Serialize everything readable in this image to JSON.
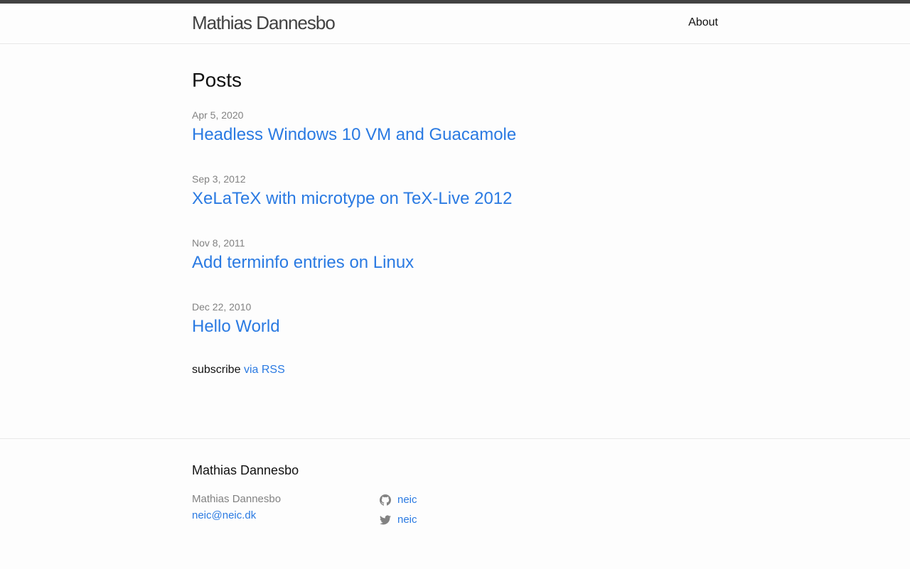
{
  "header": {
    "site_title": "Mathias Dannesbo",
    "nav": [
      {
        "label": "About"
      }
    ]
  },
  "main": {
    "heading": "Posts",
    "posts": [
      {
        "date": "Apr 5, 2020",
        "title": "Headless Windows 10 VM and Guacamole"
      },
      {
        "date": "Sep 3, 2012",
        "title": "XeLaTeX with microtype on TeX-Live 2012"
      },
      {
        "date": "Nov 8, 2011",
        "title": "Add terminfo entries on Linux"
      },
      {
        "date": "Dec 22, 2010",
        "title": "Hello World"
      }
    ],
    "subscribe_text": "subscribe",
    "subscribe_link": "via RSS"
  },
  "footer": {
    "heading": "Mathias Dannesbo",
    "name": "Mathias Dannesbo",
    "email": "neic@neic.dk",
    "social": [
      {
        "icon": "github-icon",
        "label": "neic"
      },
      {
        "icon": "twitter-icon",
        "label": "neic"
      }
    ]
  },
  "colors": {
    "link": "#2a7ae2",
    "meta": "#828282",
    "text": "#111111",
    "title": "#424242",
    "top_bar": "#424242",
    "background": "#fdfdfd",
    "border": "#e8e8e8"
  }
}
